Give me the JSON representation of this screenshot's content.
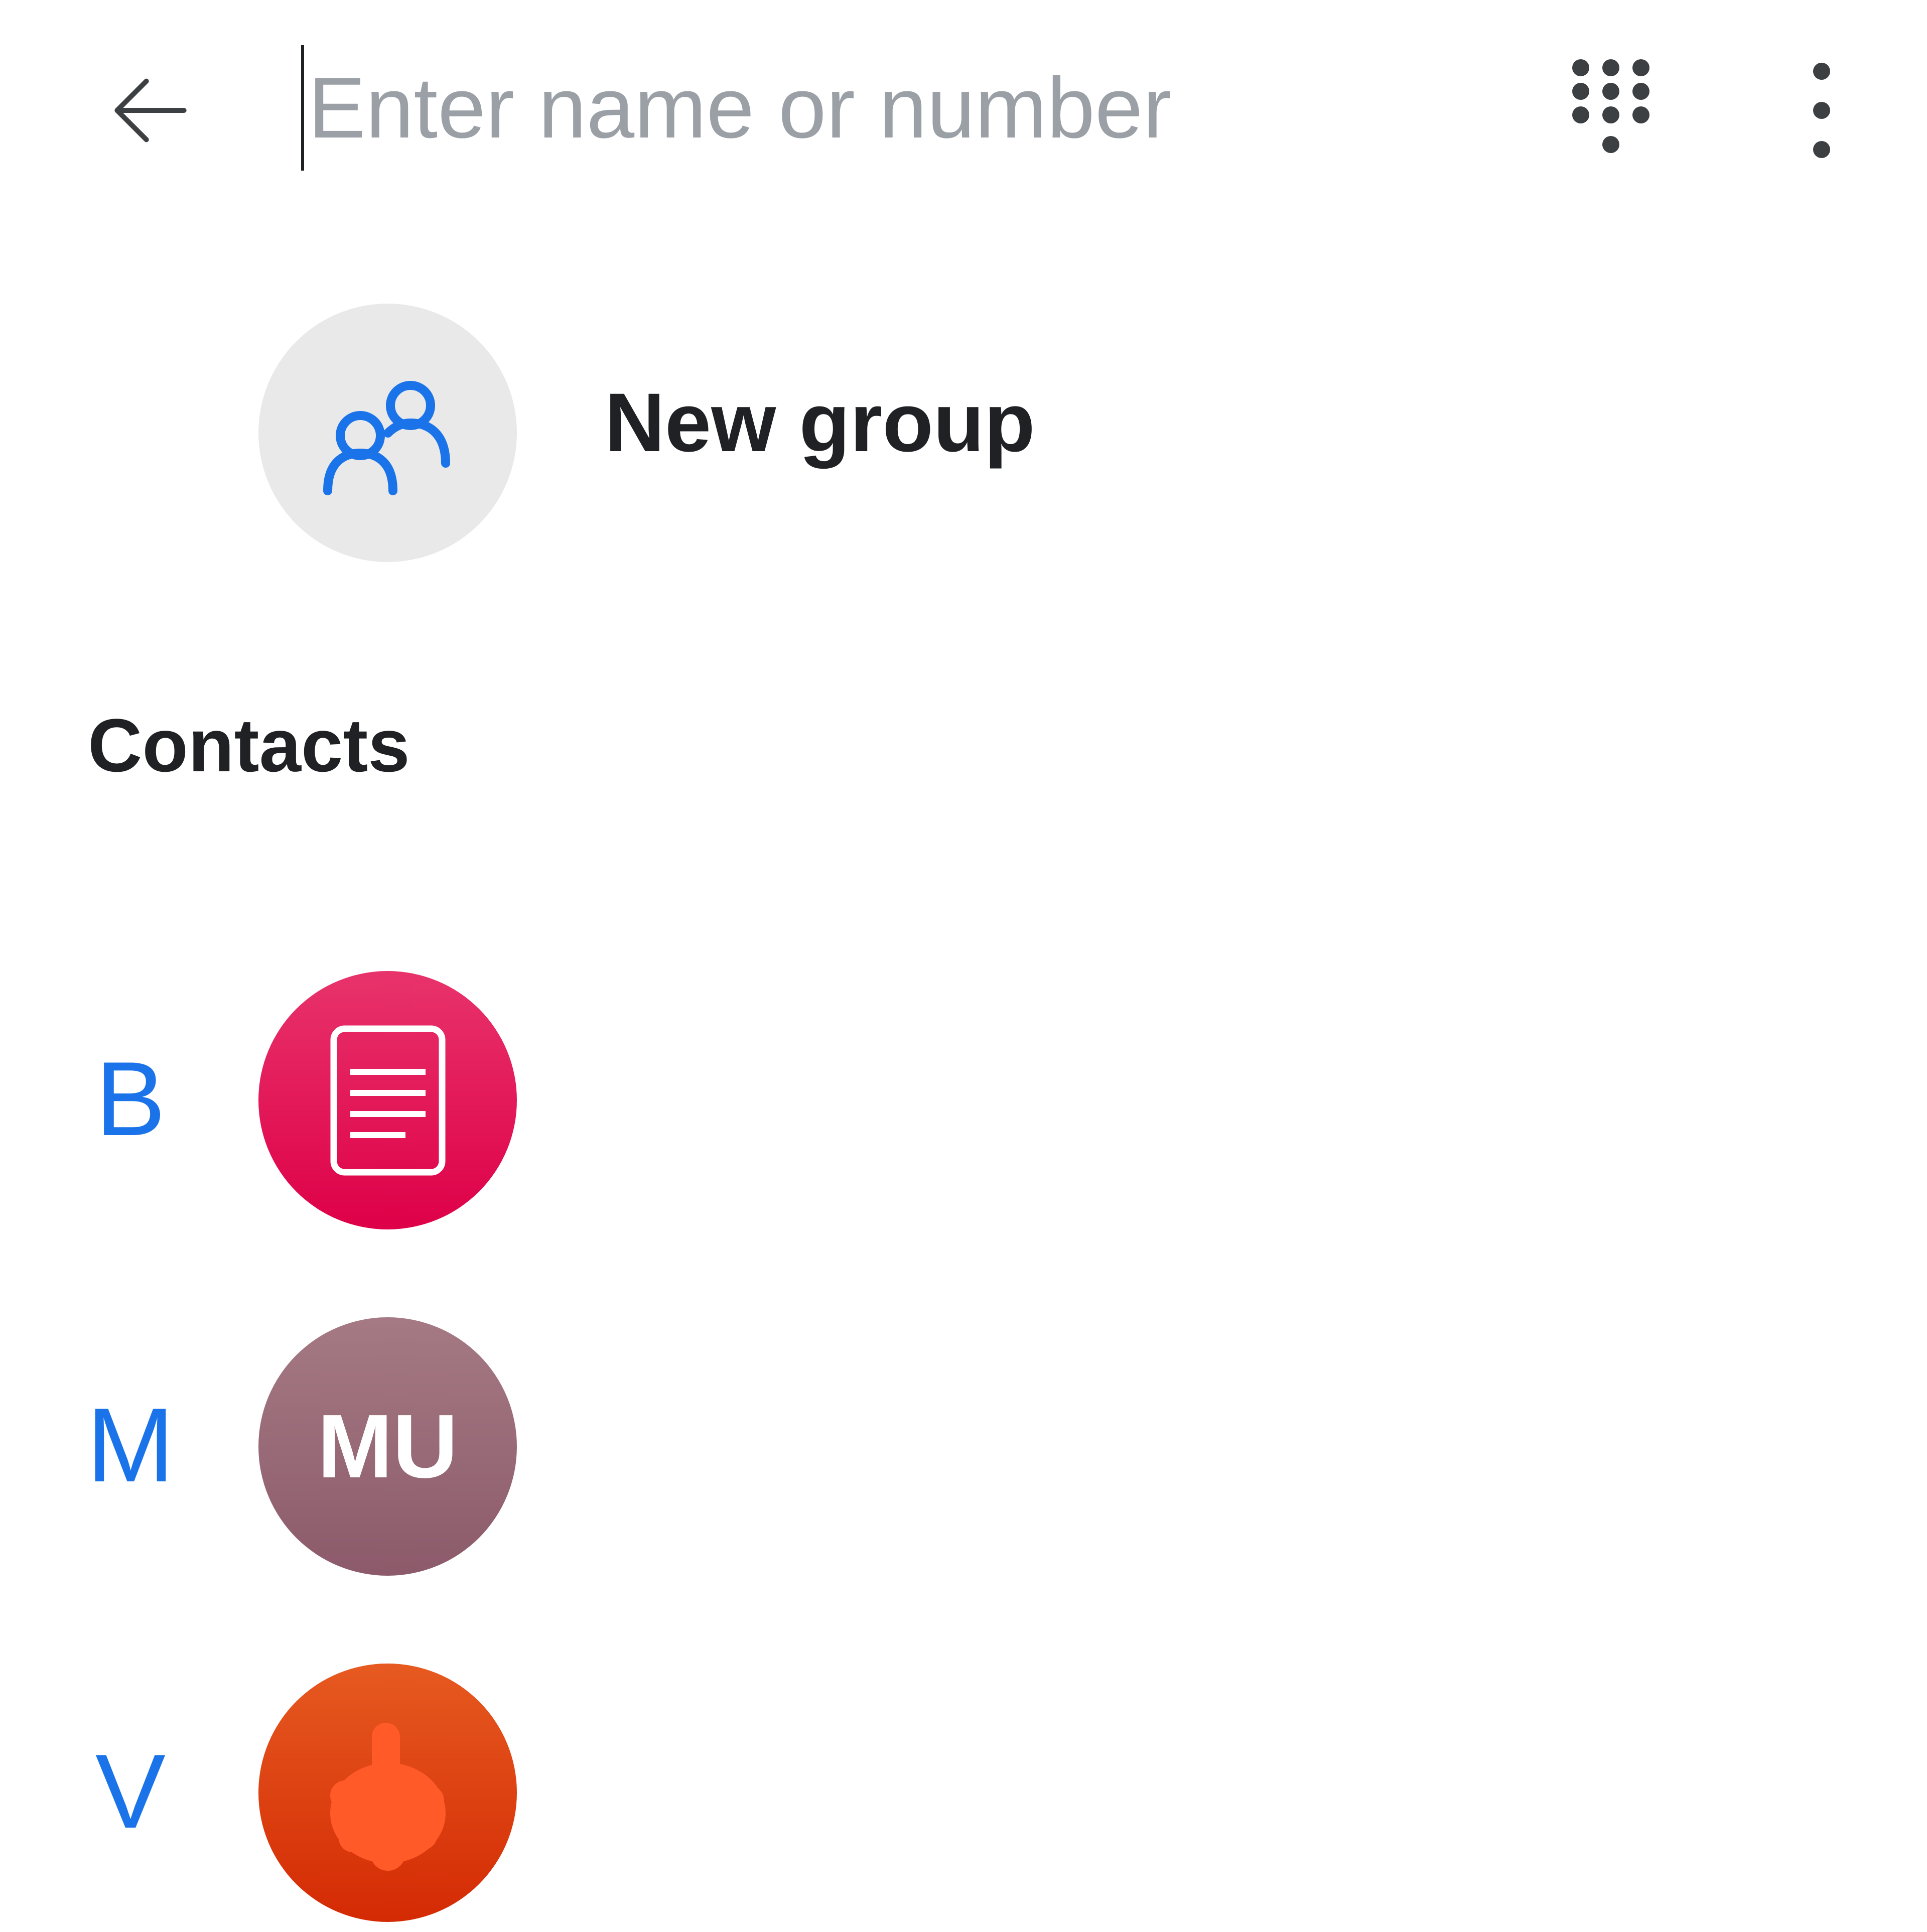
{
  "header": {
    "back_icon": "arrow-left-icon",
    "search_placeholder": "Enter name or number",
    "search_value": "",
    "dialpad_icon": "dialpad-icon",
    "more_icon": "more-vert-icon"
  },
  "new_group": {
    "label": "New group",
    "icon": "group-icon"
  },
  "contacts": {
    "header": "Contacts",
    "items": [
      {
        "letter": "B",
        "initials": "",
        "avatar_icon": "document-icon",
        "avatar_color": "#e2104f"
      },
      {
        "letter": "M",
        "initials": "MU",
        "avatar_icon": "",
        "avatar_color": "#976673"
      },
      {
        "letter": "V",
        "initials": "",
        "avatar_icon": "photo-avatar-icon",
        "avatar_color": "#dd4212"
      }
    ]
  },
  "colors": {
    "accent": "#1a73e8",
    "text_primary": "#202124",
    "placeholder": "#9aa0a6",
    "icon_bg": "#e9e9ea"
  }
}
